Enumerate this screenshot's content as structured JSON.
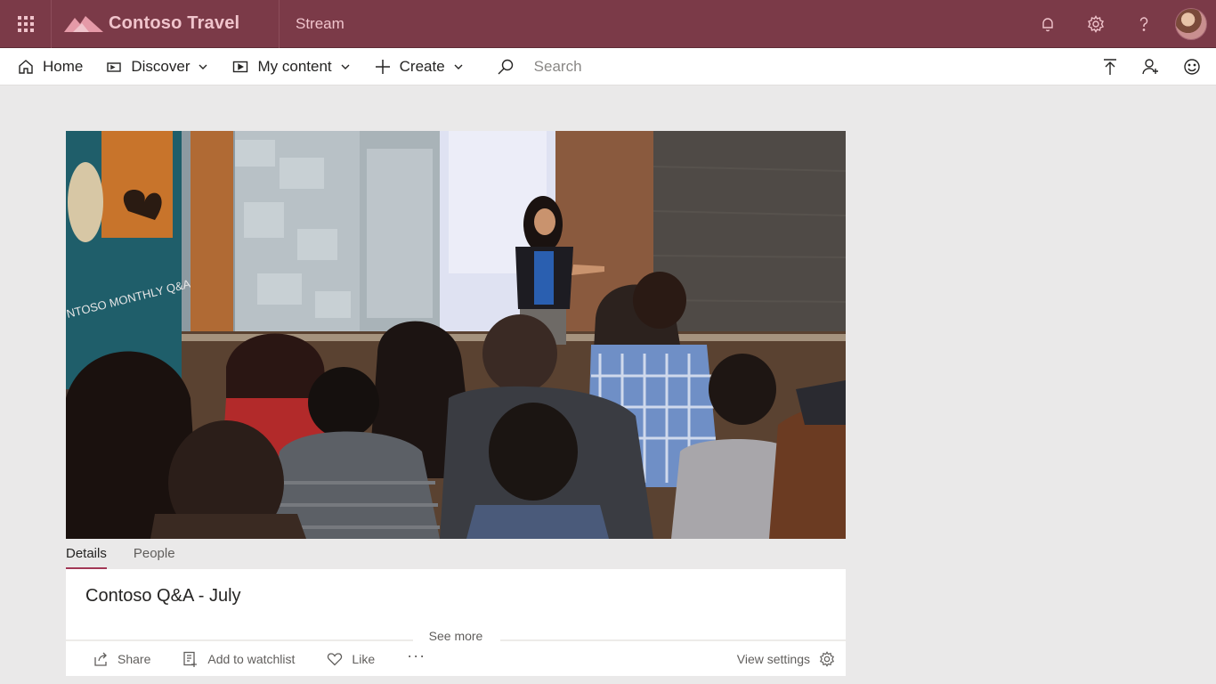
{
  "suite": {
    "brand_name": "Contoso Travel",
    "app_name": "Stream",
    "bar_color": "#7b3a48",
    "icons": [
      "waffle-icon",
      "bell-icon",
      "gear-icon",
      "help-icon",
      "avatar"
    ]
  },
  "nav": {
    "home": "Home",
    "discover": "Discover",
    "my_content": "My content",
    "create": "Create",
    "search_placeholder": "Search",
    "right_icons": [
      "upload-icon",
      "add-person-icon",
      "smiley-icon"
    ]
  },
  "video": {
    "overlay_text": "NTOSO MONTHLY Q&A"
  },
  "tabs": {
    "details": "Details",
    "people": "People",
    "active": "Details",
    "active_color": "#a23856"
  },
  "details": {
    "title": "Contoso Q&A - July",
    "see_more": "See more",
    "actions": {
      "share": "Share",
      "add_to_watchlist": "Add to watchlist",
      "like": "Like",
      "more": "···",
      "view_settings": "View settings"
    }
  }
}
